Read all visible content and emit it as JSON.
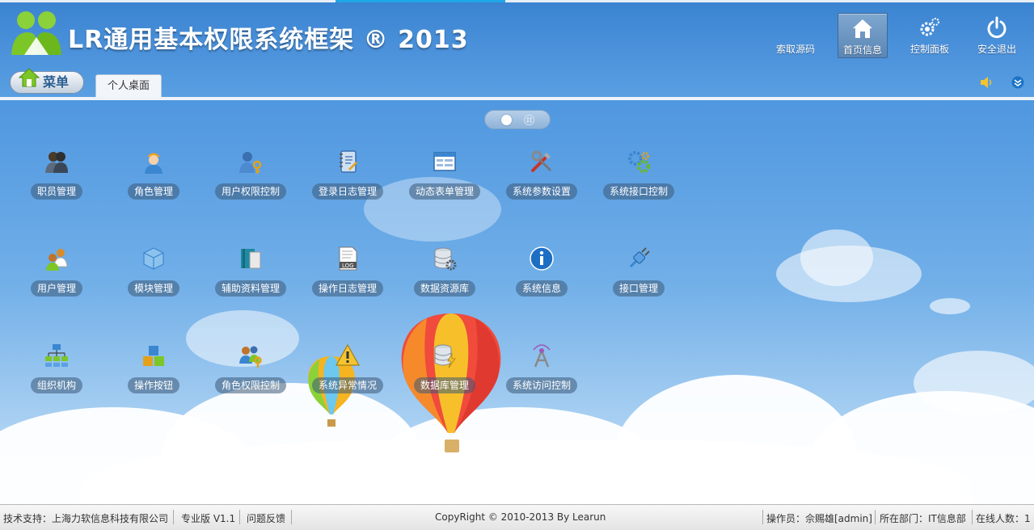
{
  "header": {
    "title": "LR通用基本权限系统框架 ® 2013",
    "buttons": [
      {
        "label": "索取源码",
        "icon": "source-code-icon"
      },
      {
        "label": "首页信息",
        "icon": "home-icon",
        "active": true
      },
      {
        "label": "控制面板",
        "icon": "gear-icon"
      },
      {
        "label": "安全退出",
        "icon": "power-icon"
      }
    ]
  },
  "nav": {
    "menu_label": "菜单",
    "tab_label": "个人桌面"
  },
  "apps": [
    {
      "label": "职员管理",
      "icon": "staff-icon"
    },
    {
      "label": "角色管理",
      "icon": "worker-icon"
    },
    {
      "label": "用户权限控制",
      "icon": "user-key-icon"
    },
    {
      "label": "登录日志管理",
      "icon": "notebook-icon"
    },
    {
      "label": "动态表单管理",
      "icon": "form-icon"
    },
    {
      "label": "系统参数设置",
      "icon": "tools-icon"
    },
    {
      "label": "系统接口控制",
      "icon": "gears-icon"
    },
    {
      "label": "用户管理",
      "icon": "users-icon"
    },
    {
      "label": "模块管理",
      "icon": "module-cube-icon"
    },
    {
      "label": "辅助资料管理",
      "icon": "book-icon"
    },
    {
      "label": "操作日志管理",
      "icon": "log-file-icon"
    },
    {
      "label": "数据资源库",
      "icon": "database-gear-icon"
    },
    {
      "label": "系统信息",
      "icon": "info-icon"
    },
    {
      "label": "接口管理",
      "icon": "plug-icon"
    },
    {
      "label": "组织机构",
      "icon": "org-chart-icon"
    },
    {
      "label": "操作按钮",
      "icon": "blocks-icon"
    },
    {
      "label": "角色权限控制",
      "icon": "role-key-icon"
    },
    {
      "label": "系统异常情况",
      "icon": "warning-icon"
    },
    {
      "label": "数据库管理",
      "icon": "database-bolt-icon"
    },
    {
      "label": "系统访问控制",
      "icon": "antenna-icon"
    }
  ],
  "status": {
    "support": "技术支持：上海力软信息科技有限公司",
    "edition": "专业版 V1.1",
    "feedback": "问题反馈",
    "copyright": "CopyRight © 2010-2013 By Learun",
    "operator": "操作员：佘赐雄[admin]",
    "department": "所在部门：IT信息部",
    "online": "在线人数：1"
  },
  "colors": {
    "header_bg": "#4a90da",
    "accent": "#1fa7e6",
    "label_bg": "#3c5a78"
  }
}
